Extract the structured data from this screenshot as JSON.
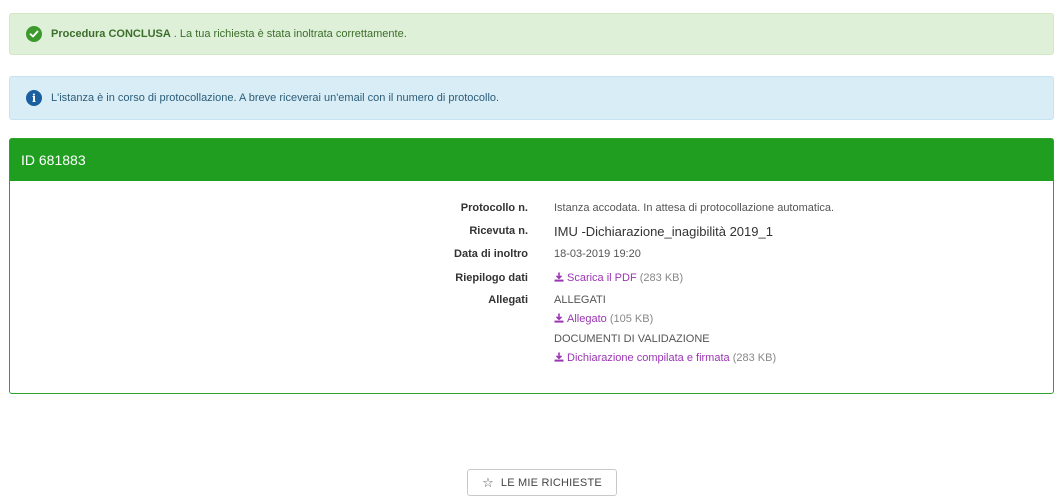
{
  "alerts": {
    "success": {
      "strong": "Procedura CONCLUSA",
      "text": ". La tua richiesta è stata inoltrata correttamente."
    },
    "info": {
      "icon_glyph": "i",
      "text": "L'istanza è in corso di protocollazione. A breve riceverai un'email con il numero di protocollo."
    }
  },
  "panel": {
    "title": "ID 681883",
    "rows": {
      "protocollo": {
        "label": "Protocollo n.",
        "value": "Istanza accodata. In attesa di protocollazione automatica."
      },
      "ricevuta": {
        "label": "Ricevuta n.",
        "value": "IMU -Dichiarazione_inagibilità 2019_1"
      },
      "data": {
        "label": "Data di inoltro",
        "value": "18-03-2019 19:20"
      },
      "riepilogo": {
        "label": "Riepilogo dati",
        "link": "Scarica il PDF",
        "size": "(283 KB)"
      },
      "allegati": {
        "label": "Allegati",
        "group1": "ALLEGATI",
        "link1": "Allegato",
        "size1": "(105 KB)",
        "group2": "DOCUMENTI DI VALIDAZIONE",
        "link2": "Dichiarazione compilata e firmata",
        "size2": "(283 KB)"
      }
    }
  },
  "button": {
    "label": "LE MIE RICHIESTE"
  },
  "colors": {
    "success_bg": "#dff0d8",
    "info_bg": "#d9edf7",
    "panel_header": "#1f9e1f",
    "link": "#9b35b3"
  }
}
